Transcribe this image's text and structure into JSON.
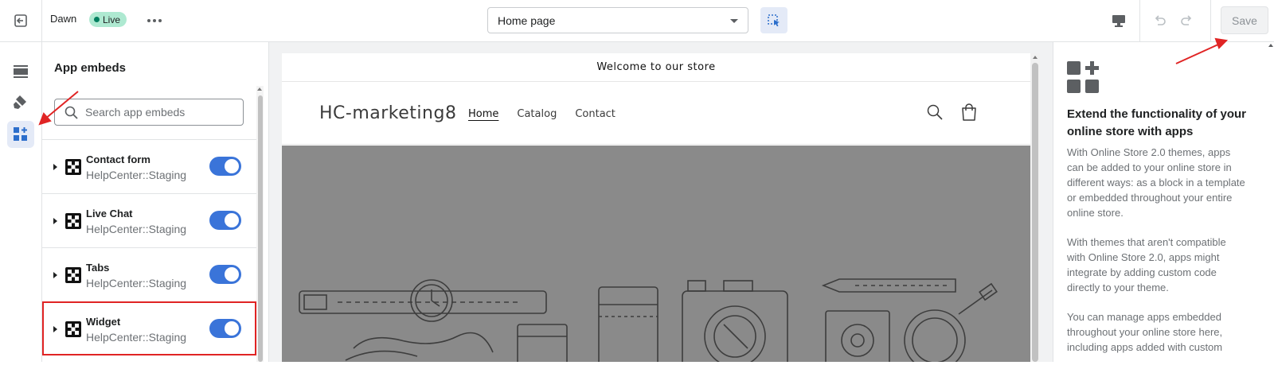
{
  "topbar": {
    "theme_name": "Dawn",
    "live_badge": "Live",
    "page_select_value": "Home page",
    "save_label": "Save"
  },
  "rail": {
    "items": [
      {
        "icon": "sections-icon"
      },
      {
        "icon": "theme-settings-brush-icon"
      },
      {
        "icon": "app-embeds-icon",
        "active": true
      }
    ]
  },
  "panel": {
    "title": "App embeds",
    "search_placeholder": "Search app embeds",
    "embeds": [
      {
        "title": "Contact form",
        "subtitle": "HelpCenter::Staging",
        "enabled": true
      },
      {
        "title": "Live Chat",
        "subtitle": "HelpCenter::Staging",
        "enabled": true
      },
      {
        "title": "Tabs",
        "subtitle": "HelpCenter::Staging",
        "enabled": true
      },
      {
        "title": "Widget",
        "subtitle": "HelpCenter::Staging",
        "enabled": true,
        "highlighted": true
      }
    ]
  },
  "preview": {
    "announcement": "Welcome to our store",
    "store_name": "HC-marketing8",
    "nav": [
      "Home",
      "Catalog",
      "Contact"
    ],
    "active_nav": "Home"
  },
  "info_panel": {
    "title": "Extend the functionality of your online store with apps",
    "paragraphs": [
      "With Online Store 2.0 themes, apps can be added to your online store in different ways: as a block in a template or embedded throughout your entire online store.",
      "With themes that aren't compatible with Online Store 2.0, apps might integrate by adding custom code directly to your theme.",
      "You can manage apps embedded throughout your online store here, including apps added with custom"
    ]
  },
  "colors": {
    "accent": "#3a74d9",
    "live_badge_bg": "#aee9d1",
    "highlight_red": "#e02424",
    "hero_gray": "#8a8a8a"
  }
}
